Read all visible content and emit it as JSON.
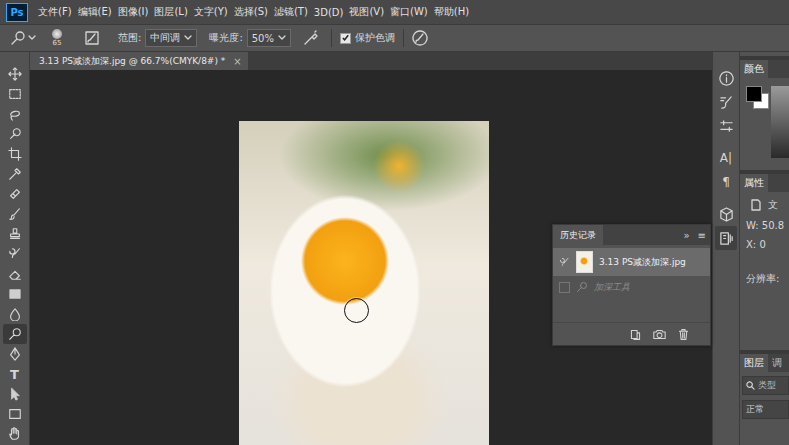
{
  "app": {
    "logo": "Ps"
  },
  "menu": [
    "文件(F)",
    "编辑(E)",
    "图像(I)",
    "图层(L)",
    "文字(Y)",
    "选择(S)",
    "滤镜(T)",
    "3D(D)",
    "视图(V)",
    "窗口(W)",
    "帮助(H)"
  ],
  "options": {
    "brush_size": "65",
    "range_label": "范围:",
    "range_value": "中间调",
    "exposure_label": "曝光度:",
    "exposure_value": "50%",
    "protect_tones": {
      "label": "保护色调",
      "checked": true
    }
  },
  "document_tab": {
    "title": "3.13 PS减淡加深.jpg @ 66.7%(CMYK/8#) *",
    "close": "×",
    "selected": true
  },
  "tools": [
    {
      "kind": "icon",
      "selected": false
    },
    {
      "kind": "icon",
      "selected": false
    },
    {
      "kind": "icon",
      "selected": false
    },
    {
      "kind": "icon",
      "selected": false
    },
    {
      "kind": "icon",
      "selected": false
    },
    {
      "kind": "icon",
      "selected": false
    },
    {
      "kind": "icon",
      "selected": false
    },
    {
      "kind": "icon",
      "selected": false
    },
    {
      "kind": "icon",
      "selected": false
    },
    {
      "kind": "icon",
      "selected": false
    },
    {
      "kind": "icon",
      "selected": false
    },
    {
      "kind": "icon",
      "selected": false
    },
    {
      "kind": "icon",
      "selected": false
    },
    {
      "kind": "icon",
      "selected": true
    },
    {
      "kind": "icon",
      "selected": false
    },
    {
      "kind": "glyph",
      "text": "T",
      "selected": false
    },
    {
      "kind": "icon",
      "selected": false
    },
    {
      "kind": "icon",
      "selected": false
    },
    {
      "kind": "icon",
      "selected": false
    }
  ],
  "brush_cursor": {
    "visible": true
  },
  "history": {
    "title": "历史记录",
    "collapse": "»",
    "menu": "≡",
    "items": [
      {
        "label": "3.13 PS减淡加深.jpg",
        "kind": "snapshot",
        "selected": true
      },
      {
        "label": "加深工具",
        "kind": "step",
        "selected": false
      }
    ]
  },
  "right_strip": [
    {
      "kind": "icon",
      "selected": false
    },
    {
      "kind": "icon",
      "selected": false
    },
    {
      "kind": "icon",
      "selected": false
    },
    {
      "kind": "glyph",
      "text": "A|",
      "selected": false
    },
    {
      "kind": "glyph",
      "text": "¶",
      "selected": false
    },
    {
      "kind": "icon",
      "selected": false
    },
    {
      "kind": "icon",
      "selected": true
    }
  ],
  "color_panel": {
    "tab": "颜色",
    "foreground": "#000000",
    "background": "#ffffff"
  },
  "properties_panel": {
    "tab": "属性",
    "section": "文",
    "fields": [
      "W: 50.8",
      "X: 0",
      "分辨率:"
    ]
  },
  "layers_panel": {
    "tabs": [
      {
        "label": "图层",
        "selected": true
      },
      {
        "label": "调",
        "selected": false
      }
    ],
    "search_placeholder": "类型",
    "blend_mode": "正常"
  }
}
